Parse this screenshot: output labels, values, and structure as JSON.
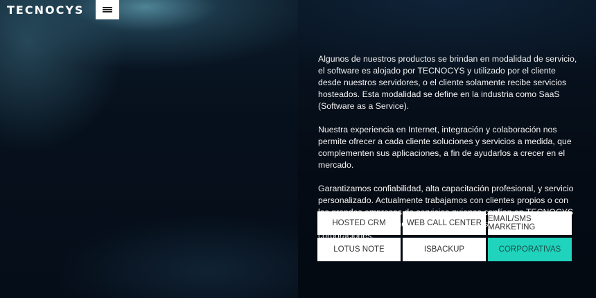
{
  "header": {
    "logo": "TECNOCYS",
    "menu_icon": "hamburger-menu-icon"
  },
  "content": {
    "paragraphs": [
      "Algunos de nuestros productos se brindan en modalidad de servicio, el software es alojado por TECNOCYS y utilizado por el cliente desde nuestros servidores, o el cliente solamente recibe servicios hosteados. Esta modalidad se define en la industria como SaaS (Software as a Service).",
      "Nuestra experiencia en Internet, integración y colaboración nos permite ofrecer a cada cliente soluciones y servicios a medida, que complementen sus aplicaciones, a fin de ayudarlos a crecer en el mercado.",
      "Garantizamos confiabilidad, alta capacitación profesional, y servicio personalizado. Actualmente trabajamos con clientes propios o con las grandes empresas de servicios quienes confían en TECNOCYS el desarrollo e implementación de soluciones en grandes corporaciones."
    ]
  },
  "services": [
    {
      "label": "HOSTED CRM",
      "active": false
    },
    {
      "label": "WEB CALL CENTER",
      "active": false
    },
    {
      "label": "EMAIL/SMS MARKETING",
      "active": false
    },
    {
      "label": "LOTUS NOTE",
      "active": false
    },
    {
      "label": "ISBACKUP",
      "active": false
    },
    {
      "label": "CORPORATIVAS",
      "active": true
    }
  ],
  "colors": {
    "accent": "#1fd3bc",
    "background": "#050b14",
    "tile": "#ffffff"
  }
}
